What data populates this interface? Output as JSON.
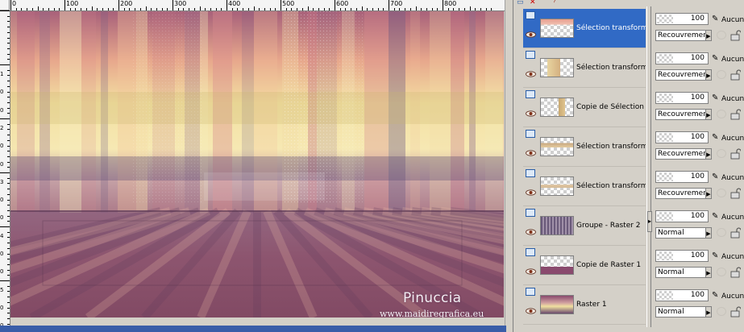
{
  "ruler": {
    "top_labels": [
      "0",
      "100",
      "200",
      "300",
      "400",
      "500",
      "600",
      "700",
      "800"
    ],
    "left_labels": [
      "1",
      "0",
      "0",
      "2",
      "0",
      "0",
      "3",
      "0",
      "0",
      "4",
      "0",
      "0",
      "5",
      "0",
      "0"
    ]
  },
  "watermark": {
    "name": "Pinuccia",
    "url": "www.maidiregrafica.eu"
  },
  "layers": [
    {
      "name": "Sélection transformée",
      "opacity": "100",
      "mask": "Aucun",
      "blend": "Recouvrement",
      "selected": true
    },
    {
      "name": "Sélection transformée",
      "opacity": "100",
      "mask": "Aucun",
      "blend": "Recouvrement",
      "selected": false
    },
    {
      "name": "Copie de Sélection transformée",
      "opacity": "100",
      "mask": "Aucun",
      "blend": "Recouvrement",
      "selected": false
    },
    {
      "name": "Sélection transformée",
      "opacity": "100",
      "mask": "Aucun",
      "blend": "Recouvrement",
      "selected": false
    },
    {
      "name": "Sélection transformée",
      "opacity": "100",
      "mask": "Aucun",
      "blend": "Recouvrement",
      "selected": false
    },
    {
      "name": "Groupe - Raster 2",
      "opacity": "100",
      "mask": "Aucun",
      "blend": "Normal",
      "selected": false
    },
    {
      "name": "Copie de Raster 1",
      "opacity": "100",
      "mask": "Aucun",
      "blend": "Normal",
      "selected": false
    },
    {
      "name": "Raster 1",
      "opacity": "100",
      "mask": "Aucun",
      "blend": "Normal",
      "selected": false
    }
  ],
  "icons": {
    "visibility": "layer-visibility-icon",
    "eye": "eye-icon",
    "brush": "brush-icon",
    "lock": "lock-icon",
    "link": "link-icon",
    "delete": "delete-icon"
  },
  "colors": {
    "selection": "#316ac5",
    "panel": "#d4d0c8",
    "accent_bar": "#3a5da8"
  }
}
